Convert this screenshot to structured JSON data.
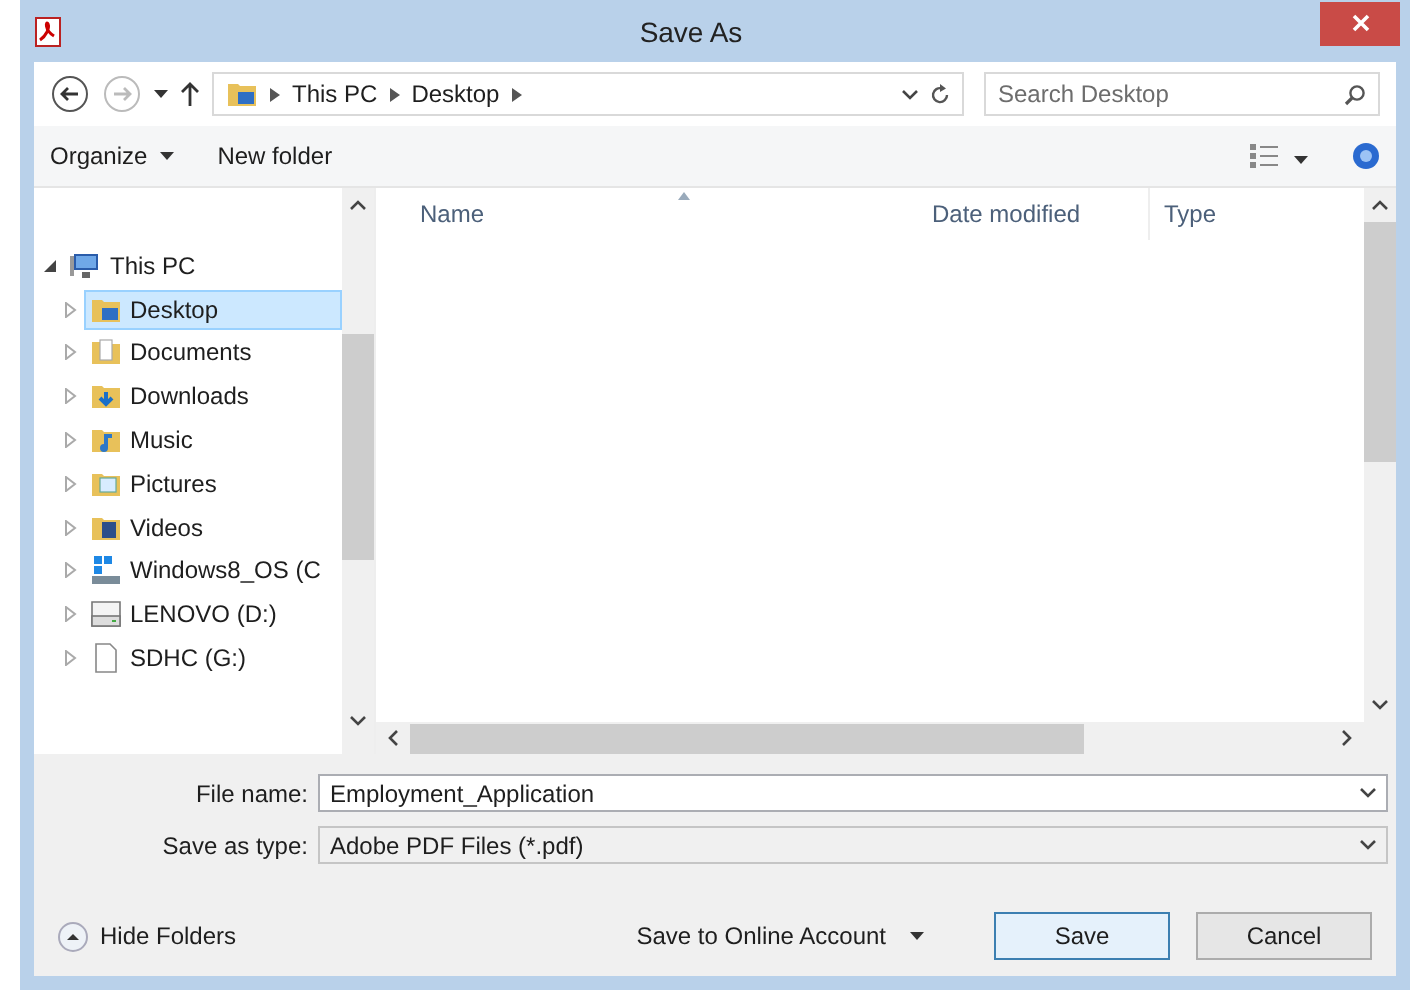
{
  "window": {
    "title": "Save As"
  },
  "address_bar": {
    "path": [
      "This PC",
      "Desktop"
    ]
  },
  "search": {
    "placeholder": "Search Desktop"
  },
  "toolbar": {
    "organize": "Organize",
    "new_folder": "New folder"
  },
  "navigation": [
    {
      "label": "This PC",
      "kind": "computer",
      "expanded": true,
      "selected": false,
      "children": [
        {
          "label": "Desktop",
          "kind": "desktop",
          "expanded": false,
          "selected": true
        },
        {
          "label": "Documents",
          "kind": "documents",
          "expanded": false,
          "selected": false
        },
        {
          "label": "Downloads",
          "kind": "downloads",
          "expanded": false,
          "selected": false
        },
        {
          "label": "Music",
          "kind": "music",
          "expanded": false,
          "selected": false
        },
        {
          "label": "Pictures",
          "kind": "pictures",
          "expanded": false,
          "selected": false
        },
        {
          "label": "Videos",
          "kind": "videos",
          "expanded": false,
          "selected": false
        },
        {
          "label": "Windows8_OS (C",
          "kind": "system",
          "expanded": false,
          "selected": false
        },
        {
          "label": "LENOVO (D:)",
          "kind": "drive",
          "expanded": false,
          "selected": false
        },
        {
          "label": "SDHC (G:)",
          "kind": "card",
          "expanded": false,
          "selected": false
        }
      ]
    }
  ],
  "columns": [
    {
      "label": "Name"
    },
    {
      "label": "Date modified"
    },
    {
      "label": "Type"
    }
  ],
  "file_name": {
    "label": "File name:",
    "value": "Employment_Application"
  },
  "save_type": {
    "label": "Save as type:",
    "value": "Adobe PDF Files (*.pdf)"
  },
  "hide_folders": "Hide Folders",
  "online_account": "Save to Online Account",
  "buttons": [
    {
      "label": "Save",
      "default": true
    },
    {
      "label": "Cancel",
      "default": false
    }
  ]
}
